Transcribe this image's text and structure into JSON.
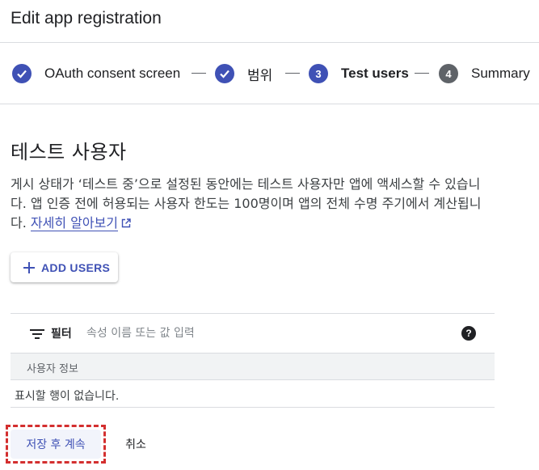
{
  "header": {
    "title": "Edit app registration"
  },
  "stepper": {
    "steps": [
      {
        "label": "OAuth consent screen",
        "state": "done"
      },
      {
        "label": "범위",
        "state": "done"
      },
      {
        "label": "Test users",
        "state": "active",
        "number": "3"
      },
      {
        "label": "Summary",
        "state": "todo",
        "number": "4"
      }
    ]
  },
  "section": {
    "title": "테스트 사용자",
    "description": "게시 상태가 ‘테스트 중’으로 설정된 동안에는 테스트 사용자만 앱에 액세스할 수 있습니다. 앱 인증 전에 허용되는 사용자 한도는 100명이며 앱의 전체 수명 주기에서 계산됩니다. ",
    "learn_more": "자세히 알아보기"
  },
  "add_users": {
    "label": "ADD USERS"
  },
  "table": {
    "filter_label": "필터",
    "filter_placeholder": "속성 이름 또는 값 입력",
    "help": "?",
    "column_header": "사용자 정보",
    "empty_message": "표시할 행이 없습니다."
  },
  "actions": {
    "save_label": "저장 후 계속",
    "cancel_label": "취소"
  },
  "colors": {
    "accent": "#3f51b5",
    "highlight": "#d32f2f"
  }
}
